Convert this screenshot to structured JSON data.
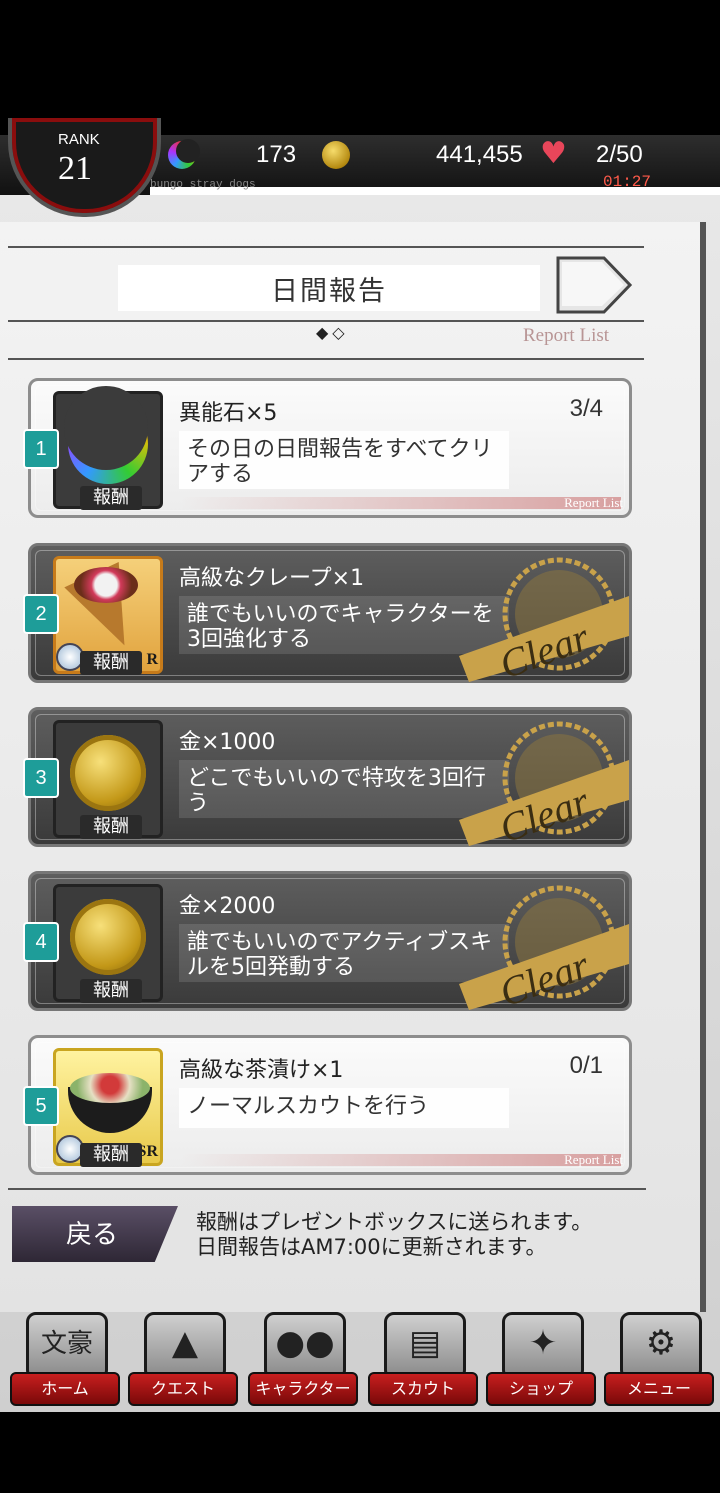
{
  "status": {
    "rank_label": "RANK",
    "rank_value": "21",
    "stones": "173",
    "money": "441,455",
    "ap": "2/50",
    "timer": "01:27",
    "subtitle": "bungo stray dogs"
  },
  "header": {
    "title": "日間報告",
    "page_dots": "◆◇",
    "report_list_link": "Report List"
  },
  "missions": [
    {
      "number": "1",
      "reward": "異能石×5",
      "text": "その日の日間報告をすべてクリアする",
      "progress": "3/4",
      "reward_tag": "報酬",
      "footer": "Report List"
    },
    {
      "number": "2",
      "reward": "高級なクレープ×1",
      "text": "誰でもいいのでキャラクターを3回強化する",
      "reward_tag": "報酬",
      "rarity": "R",
      "stamp": "Clear"
    },
    {
      "number": "3",
      "reward": "金×1000",
      "text": "どこでもいいので特攻を3回行う",
      "reward_tag": "報酬",
      "stamp": "Clear"
    },
    {
      "number": "4",
      "reward": "金×2000",
      "text": "誰でもいいのでアクティブスキルを5回発動する",
      "reward_tag": "報酬",
      "stamp": "Clear"
    },
    {
      "number": "5",
      "reward": "高級な茶漬け×1",
      "text": "ノーマルスカウトを行う",
      "progress": "0/1",
      "reward_tag": "報酬",
      "rarity": "SR",
      "footer": "Report List"
    }
  ],
  "footer": {
    "back_label": "戻る",
    "note_line1": "報酬はプレゼントボックスに送られます。",
    "note_line2": "日間報告はAM7:00に更新されます。"
  },
  "nav": {
    "home_badge": "文豪",
    "home": "ホーム",
    "quest": "クエスト",
    "character": "キャラクター",
    "scout": "スカウト",
    "shop": "ショップ",
    "menu": "メニュー"
  },
  "colors": {
    "accent_teal": "#1e9d99",
    "timer_red": "#ff5a4a",
    "nav_red": "#c81f1f",
    "stamp_gold": "#c9a24a"
  }
}
